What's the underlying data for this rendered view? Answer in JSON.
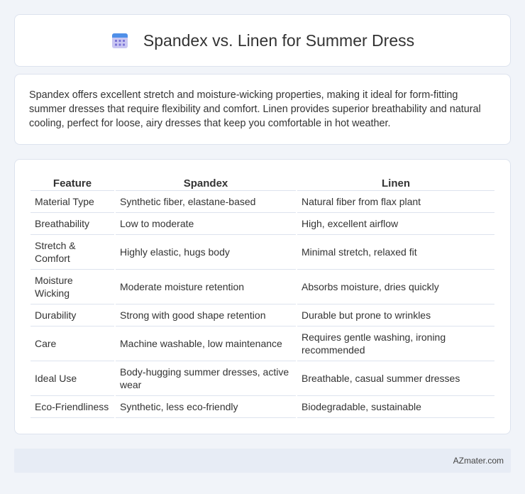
{
  "header": {
    "title": "Spandex vs. Linen for Summer Dress",
    "icon": "calendar-icon"
  },
  "intro": {
    "text": "Spandex offers excellent stretch and moisture-wicking properties, making it ideal for form-fitting summer dresses that require flexibility and comfort. Linen provides superior breathability and natural cooling, perfect for loose, airy dresses that keep you comfortable in hot weather."
  },
  "table": {
    "headers": [
      "Feature",
      "Spandex",
      "Linen"
    ],
    "rows": [
      [
        "Material Type",
        "Synthetic fiber, elastane-based",
        "Natural fiber from flax plant"
      ],
      [
        "Breathability",
        "Low to moderate",
        "High, excellent airflow"
      ],
      [
        "Stretch & Comfort",
        "Highly elastic, hugs body",
        "Minimal stretch, relaxed fit"
      ],
      [
        "Moisture Wicking",
        "Moderate moisture retention",
        "Absorbs moisture, dries quickly"
      ],
      [
        "Durability",
        "Strong with good shape retention",
        "Durable but prone to wrinkles"
      ],
      [
        "Care",
        "Machine washable, low maintenance",
        "Requires gentle washing, ironing recommended"
      ],
      [
        "Ideal Use",
        "Body-hugging summer dresses, active wear",
        "Breathable, casual summer dresses"
      ],
      [
        "Eco-Friendliness",
        "Synthetic, less eco-friendly",
        "Biodegradable, sustainable"
      ]
    ]
  },
  "footer": {
    "text": "AZmater.com"
  }
}
